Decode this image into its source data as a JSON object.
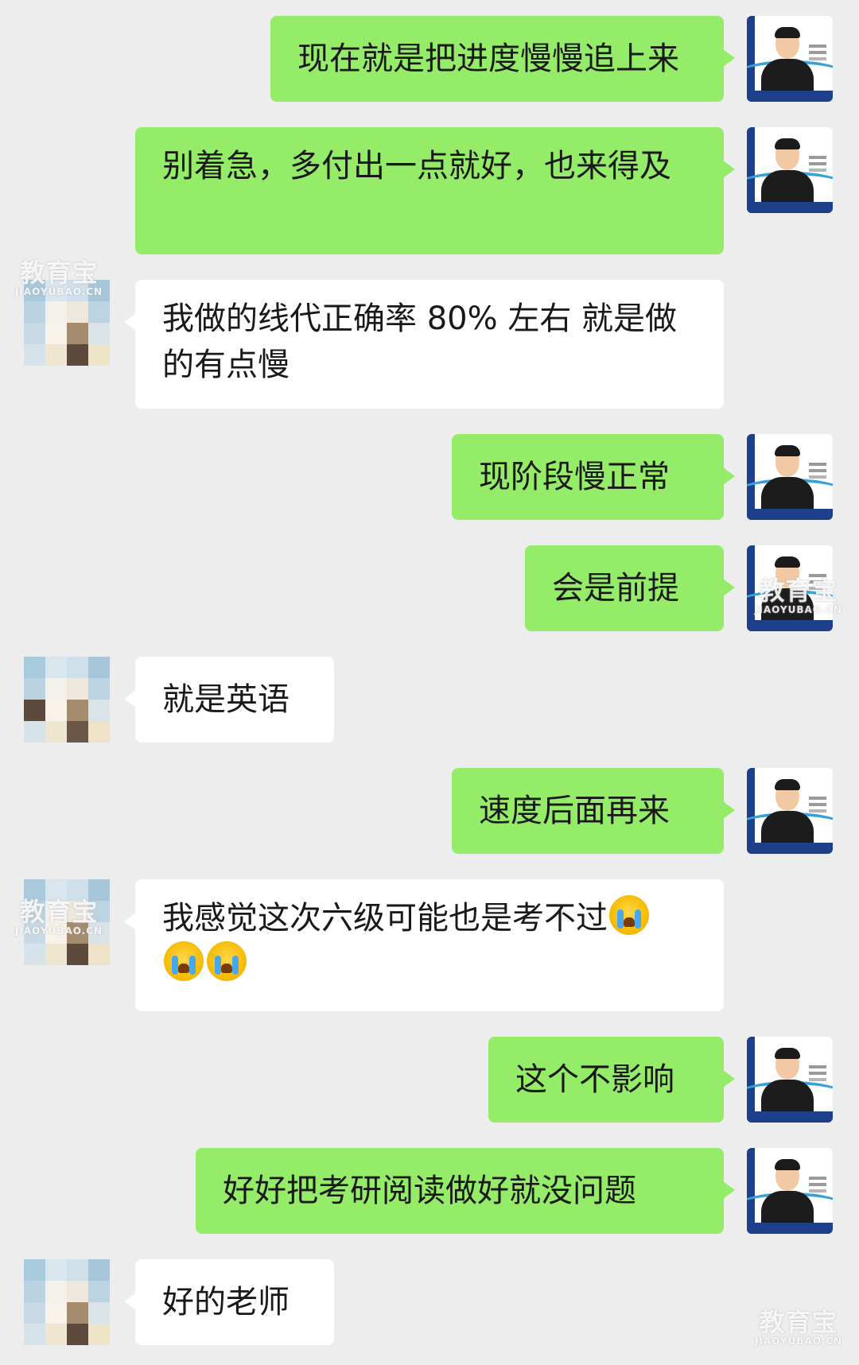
{
  "messages": [
    {
      "side": "sent",
      "text": "现在就是把进度慢慢追上来"
    },
    {
      "side": "sent",
      "text": "别着急，多付出一点就好，也来得及"
    },
    {
      "side": "recv",
      "text": "我做的线代正确率 80% 左右 就是做的有点慢"
    },
    {
      "side": "sent",
      "text": "现阶段慢正常"
    },
    {
      "side": "sent",
      "text": "会是前提"
    },
    {
      "side": "recv",
      "text": "就是英语"
    },
    {
      "side": "sent",
      "text": "速度后面再来"
    },
    {
      "side": "recv",
      "text": "我感觉这次六级可能也是考不过",
      "emojis": [
        "loudly-crying-face",
        "loudly-crying-face",
        "loudly-crying-face"
      ]
    },
    {
      "side": "sent",
      "text": "这个不影响"
    },
    {
      "side": "sent",
      "text": "好好把考研阅读做好就没问题"
    },
    {
      "side": "recv",
      "text": "好的老师"
    }
  ],
  "watermark": {
    "cn": "教育宝",
    "en": "JIAOYUBAO.CN"
  },
  "colors": {
    "background": "#ededed",
    "sent_bubble": "#95ec69",
    "recv_bubble": "#ffffff"
  }
}
